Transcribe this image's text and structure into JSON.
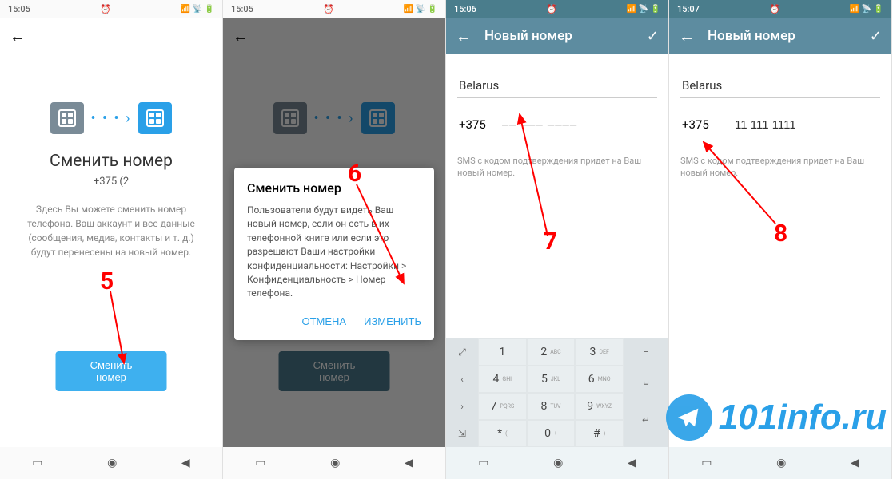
{
  "screens": [
    {
      "statusbar": {
        "time": "15:05",
        "teal": false
      },
      "title_big": "Сменить номер",
      "phone_sub": "+375 (2",
      "desc": "Здесь Вы можете сменить номер телефона. Ваш аккаунт и все данные (сообщения, медиа, контакты и т. д.) будут перенесены на новый номер.",
      "button": "Сменить номер"
    },
    {
      "statusbar": {
        "time": "15:05",
        "teal": false
      },
      "button": "Сменить номер",
      "dialog": {
        "title": "Сменить номер",
        "body": "Пользователи будут видеть Ваш новый номер, если он есть в их телефонной книге или если это разрешают Ваши настройки конфиденциальности: Настройки > Конфиденциальность > Номер телефона.",
        "cancel": "ОТМЕНА",
        "confirm": "ИЗМЕНИТЬ"
      }
    },
    {
      "statusbar": {
        "time": "15:06",
        "teal": true
      },
      "toolbar_title": "Новый номер",
      "country": "Belarus",
      "code": "+375",
      "phone_placeholder": "–– ––– ––––",
      "phone_value": "",
      "sms_hint": "SMS с кодом подтверждения придет на Ваш новый номер."
    },
    {
      "statusbar": {
        "time": "15:07",
        "teal": true
      },
      "toolbar_title": "Новый номер",
      "country": "Belarus",
      "code": "+375",
      "phone_placeholder": "",
      "phone_value": "11 111 1111",
      "sms_hint": "SMS с кодом подтверждения придет на Ваш новый номер."
    }
  ],
  "keypad": {
    "keys": [
      [
        "1",
        ""
      ],
      [
        "2",
        "ABC"
      ],
      [
        "3",
        "DEF"
      ],
      [
        "4",
        "GHI"
      ],
      [
        "5",
        "JKL"
      ],
      [
        "6",
        "MNO"
      ],
      [
        "7",
        "PQRS"
      ],
      [
        "8",
        "TUV"
      ],
      [
        "9",
        "WXYZ"
      ],
      [
        "*",
        "("
      ],
      [
        "0",
        "+"
      ],
      [
        "#",
        ")"
      ]
    ],
    "side_right": [
      "–",
      "␣",
      "↵",
      ""
    ]
  },
  "annotations": {
    "a5": "5",
    "a6": "6",
    "a7": "7",
    "a8": "8"
  },
  "watermark": "101info.ru"
}
